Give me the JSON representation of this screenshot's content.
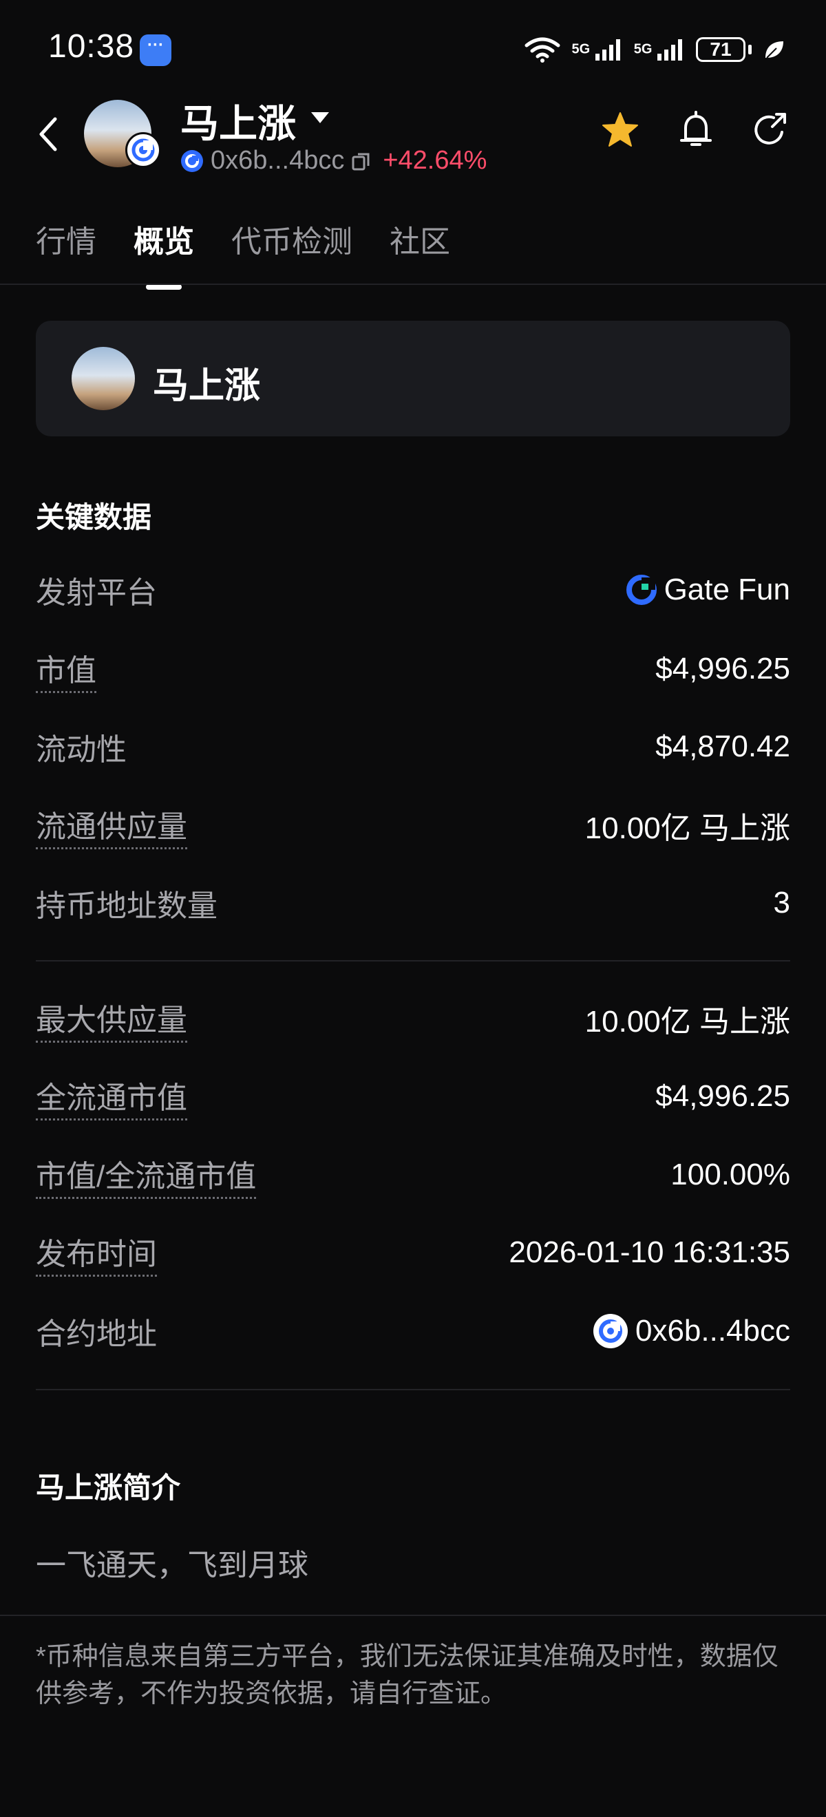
{
  "status_bar": {
    "time": "10:38",
    "battery": "71",
    "signal1": "5G",
    "signal2": "5G"
  },
  "header": {
    "title": "马上涨",
    "address": "0x6b...4bcc",
    "change": "+42.64%"
  },
  "tabs": [
    {
      "label": "行情"
    },
    {
      "label": "概览"
    },
    {
      "label": "代币检测"
    },
    {
      "label": "社区"
    }
  ],
  "token_card": {
    "name": "马上涨"
  },
  "key_data": {
    "title": "关键数据",
    "rows": [
      {
        "label": "发射平台",
        "value": "Gate Fun"
      },
      {
        "label": "市值",
        "value": "$4,996.25"
      },
      {
        "label": "流动性",
        "value": "$4,870.42"
      },
      {
        "label": "流通供应量",
        "value": "10.00亿 马上涨"
      },
      {
        "label": "持币地址数量",
        "value": "3"
      },
      {
        "label": "最大供应量",
        "value": "10.00亿 马上涨"
      },
      {
        "label": "全流通市值",
        "value": "$4,996.25"
      },
      {
        "label": "市值/全流通市值",
        "value": "100.00%"
      },
      {
        "label": "发布时间",
        "value": "2026-01-10 16:31:35"
      },
      {
        "label": "合约地址",
        "value": "0x6b...4bcc"
      }
    ]
  },
  "intro": {
    "title": "马上涨简介",
    "text": "一飞通天，飞到月球"
  },
  "disclaimer": "*币种信息来自第三方平台，我们无法保证其准确及时性，数据仅供参考，不作为投资依据，请自行查证。",
  "colors": {
    "positive": "#ff4d6a",
    "star": "#f5b82e",
    "brand": "#2f6bff"
  }
}
